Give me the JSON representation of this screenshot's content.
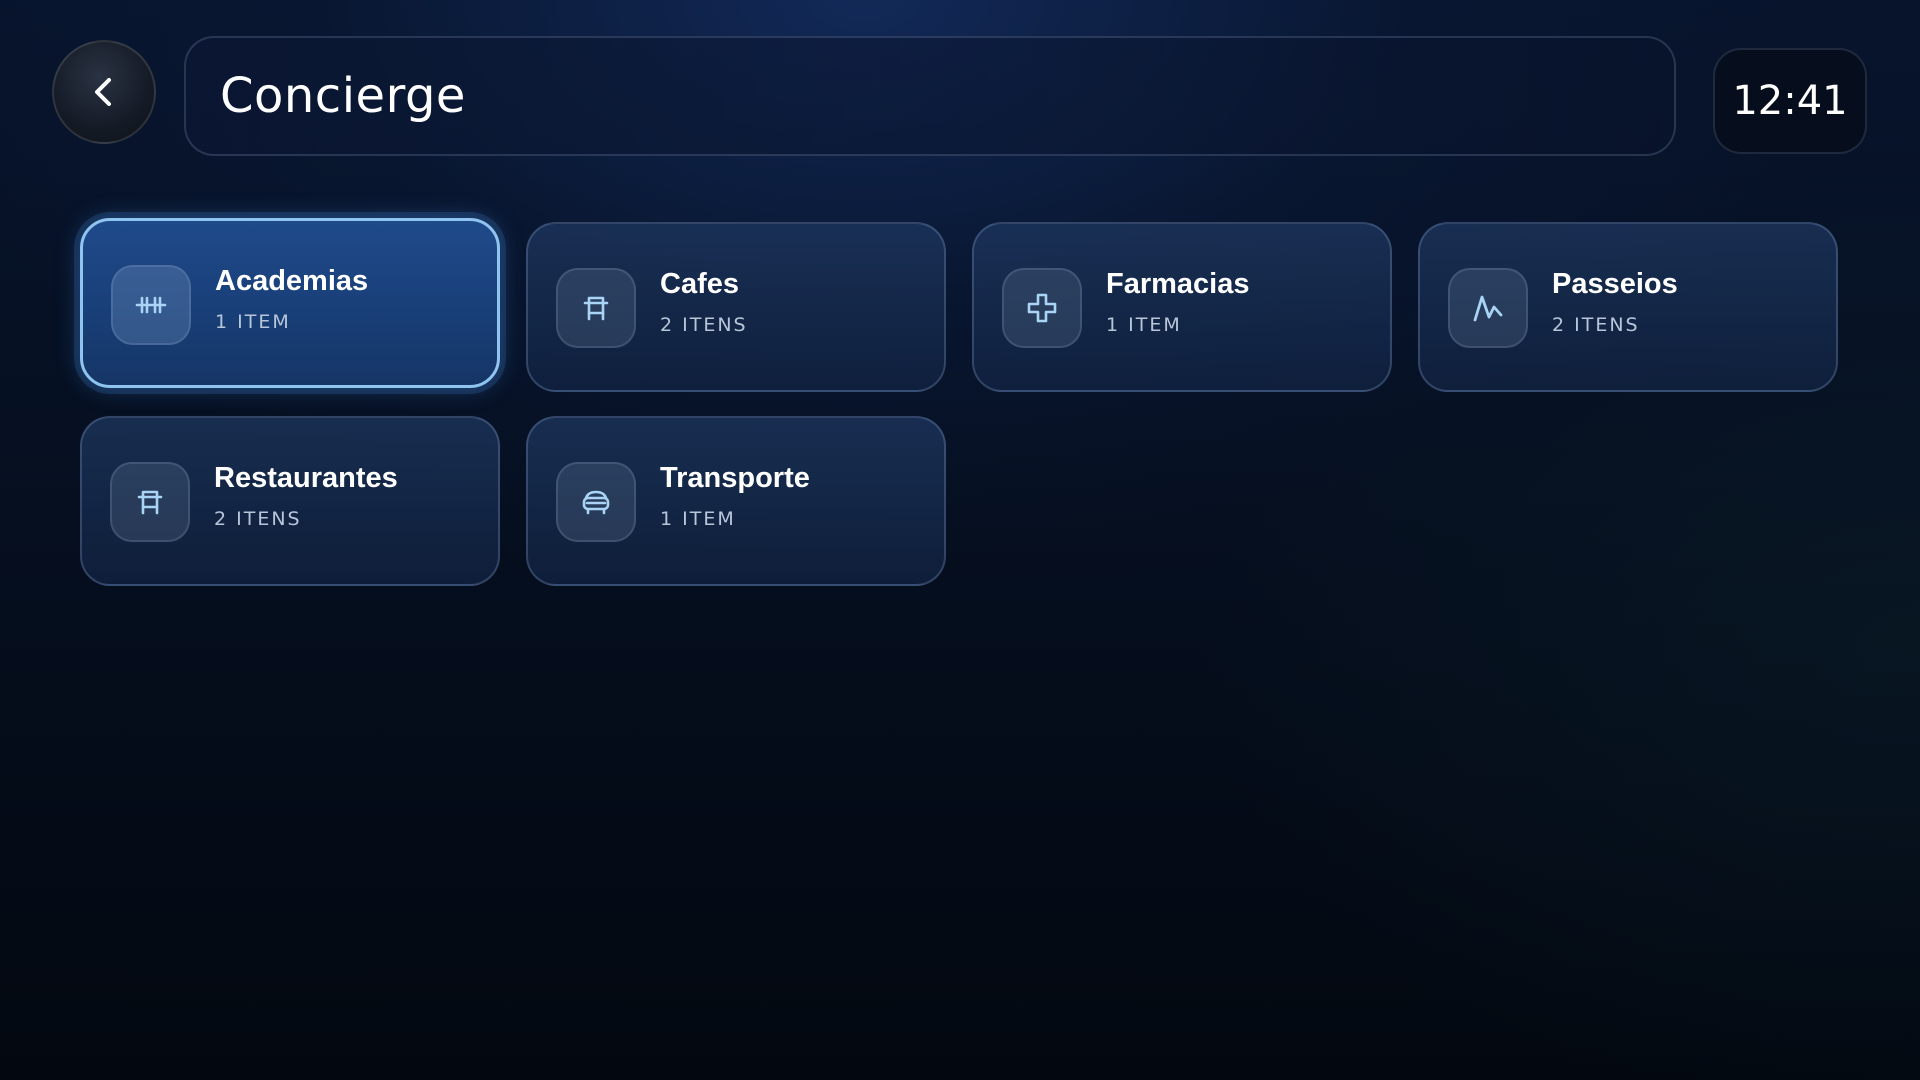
{
  "header": {
    "back_label": "Back",
    "title": "Concierge",
    "time": "12:41"
  },
  "categories": [
    {
      "name": "Academias",
      "count": "1 ITEM",
      "icon": "dumbbell-icon",
      "selected": true
    },
    {
      "name": "Cafes",
      "count": "2 ITENS",
      "icon": "table-icon",
      "selected": false
    },
    {
      "name": "Farmacias",
      "count": "1 ITEM",
      "icon": "medical-cross-icon",
      "selected": false
    },
    {
      "name": "Passeios",
      "count": "2 ITENS",
      "icon": "hiking-icon",
      "selected": false
    },
    {
      "name": "Restaurantes",
      "count": "2 ITENS",
      "icon": "table-icon",
      "selected": false
    },
    {
      "name": "Transporte",
      "count": "1 ITEM",
      "icon": "car-icon",
      "selected": false
    }
  ],
  "colors": {
    "accent": "#8fc3f0",
    "icon_stroke": "#a9d4f5",
    "selected_card": "#1f4a8a",
    "card": "#1b3660"
  }
}
